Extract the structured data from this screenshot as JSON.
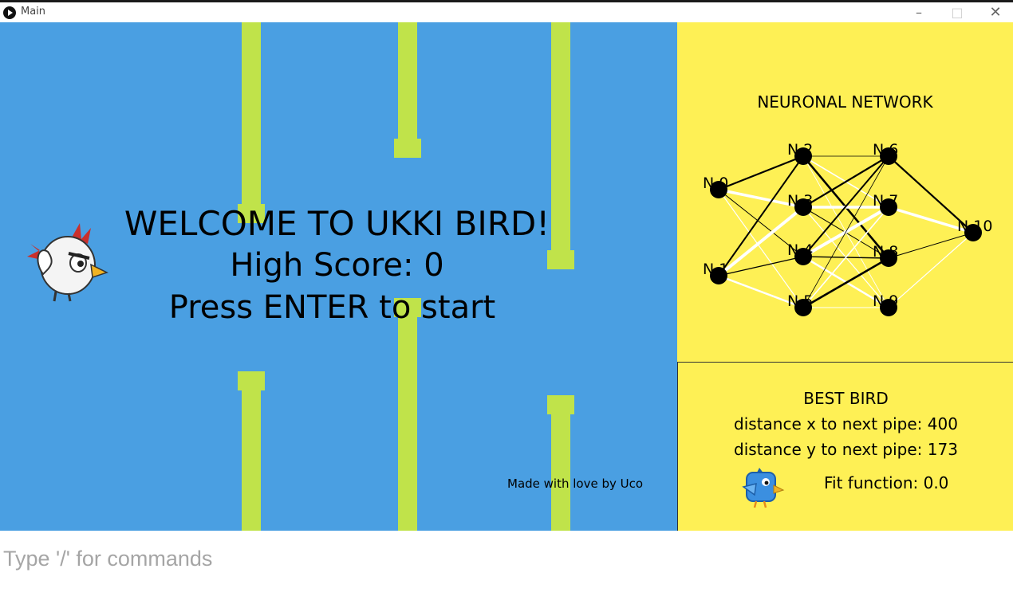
{
  "window": {
    "title": "Main",
    "minimize_symbol": "–",
    "maximize_symbol": "□",
    "close_symbol": "✕"
  },
  "game": {
    "welcome_line1": "WELCOME TO UKKI BIRD!",
    "welcome_line2": "High Score: 0",
    "welcome_line3": "Press ENTER to start",
    "credit": "Made with love by Uco",
    "pipe_color": "#c0e34a",
    "sky_color": "#4a9fe2"
  },
  "neural_network": {
    "title": "NEURONAL NETWORK",
    "nodes": [
      "N 0",
      "N 1",
      "N 2",
      "N 3",
      "N 4",
      "N 5",
      "N 6",
      "N 7",
      "N 8",
      "N 9",
      "N 10"
    ]
  },
  "best_bird": {
    "title": "BEST BIRD",
    "distance_x": "distance x to next pipe: 400",
    "distance_y": "distance y to next pipe: 173",
    "fit": "Fit function: 0.0"
  },
  "panel_color": "#fef055",
  "command_placeholder": "Type '/' for commands"
}
